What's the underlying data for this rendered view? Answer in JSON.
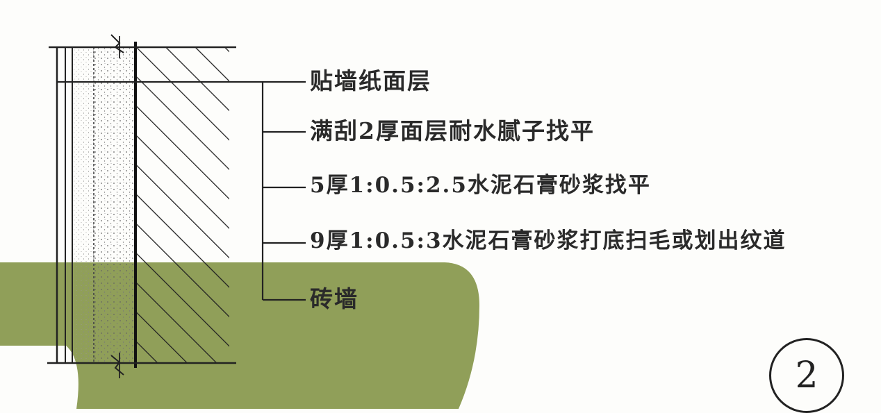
{
  "labels": [
    "贴墙纸面层",
    "满刮2厚面层耐水腻子找平",
    "5厚1:0.5:2.5水泥石膏砂浆找平",
    "9厚1:0.5:3水泥石膏砂浆打底扫毛或划出纹道",
    "砖墙"
  ],
  "detail_number": "2",
  "colors": {
    "background": "#fdfdfb",
    "green_blob": "#8a9a50",
    "line": "#222222"
  }
}
